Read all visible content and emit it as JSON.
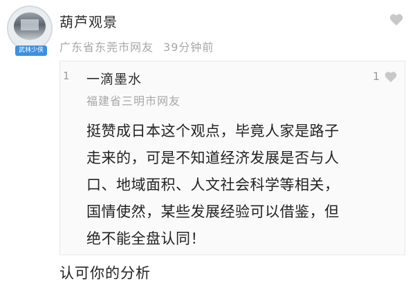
{
  "comment": {
    "avatar_badge": "武林少侠",
    "username": "葫芦观景",
    "location": "广东省东莞市网友",
    "time": "39分钟前",
    "like_icon": "heart-icon",
    "reply_text": "认可你的分析"
  },
  "quoted": {
    "index": "1",
    "username": "一滴墨水",
    "location": "福建省三明市网友",
    "like_count": "1",
    "like_icon": "heart-icon",
    "lines": [
      "挺赞成日本这个观点，毕竟人家是路子",
      "走来的，可是不知道经济发展是否与人",
      "口、地域面积、人文社会科学等相关，",
      "国情使然，某些发展经验可以借鉴，但",
      "绝不能全盘认同！"
    ]
  },
  "colors": {
    "badge_bg": "#3d8fe0",
    "meta_gray": "#a7a7a7",
    "heart_gray": "#c8c8c8",
    "quote_bg": "#fafafa"
  }
}
